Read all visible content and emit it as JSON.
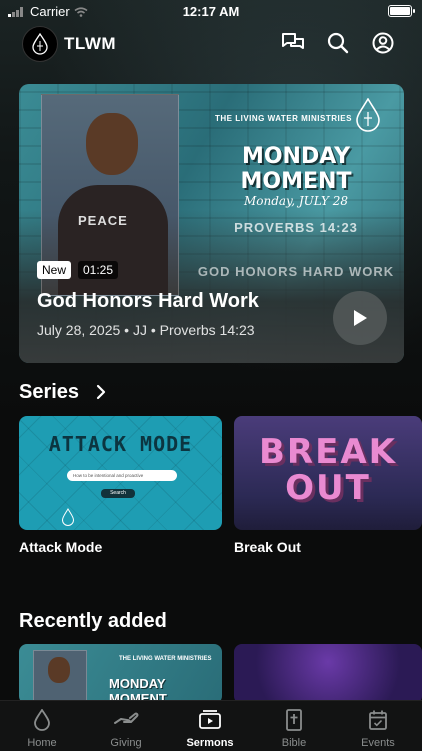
{
  "status_bar": {
    "carrier": "Carrier",
    "time": "12:17 AM"
  },
  "header": {
    "title": "TLWM",
    "icons": [
      "chat-icon",
      "search-icon",
      "profile-icon"
    ]
  },
  "hero": {
    "ministry_name": "THE LIVING WATER MINISTRIES",
    "artwork_title": "MONDAY MOMENT",
    "artwork_date": "Monday, JULY 28",
    "artwork_verse": "PROVERBS 14:23",
    "artwork_subtitle": "GOD HONORS HARD WORK",
    "shirt_text": "PEACE",
    "badge": "New",
    "duration": "01:25",
    "title": "God Honors Hard Work",
    "meta": "July 28, 2025 • JJ • Proverbs 14:23"
  },
  "series": {
    "heading": "Series",
    "items": [
      {
        "label": "Attack Mode",
        "art_title": "ATTACK MODE",
        "art_search_text": "How to be intentional and proactive",
        "art_button": "Search",
        "color": "#1e9db3"
      },
      {
        "label": "Break Out",
        "art_line1": "BREAK",
        "art_line2": "OUT",
        "color": "#e98ad1"
      }
    ]
  },
  "recent": {
    "heading": "Recently added",
    "items": [
      {
        "art_ministry": "THE LIVING WATER MINISTRIES",
        "art_title": "MONDAY MOMENT"
      },
      {
        "art_title": ""
      }
    ]
  },
  "tabbar": {
    "tabs": [
      {
        "label": "Home",
        "icon": "drop-icon",
        "active": false
      },
      {
        "label": "Giving",
        "icon": "giving-hand-icon",
        "active": false
      },
      {
        "label": "Sermons",
        "icon": "play-box-icon",
        "active": true
      },
      {
        "label": "Bible",
        "icon": "bible-icon",
        "active": false
      },
      {
        "label": "Events",
        "icon": "calendar-icon",
        "active": false
      }
    ]
  },
  "colors": {
    "background": "#0b0c0c",
    "hero_teal": "#3b8c95",
    "tab_inactive": "#8a8d8d",
    "tab_active": "#ffffff"
  }
}
